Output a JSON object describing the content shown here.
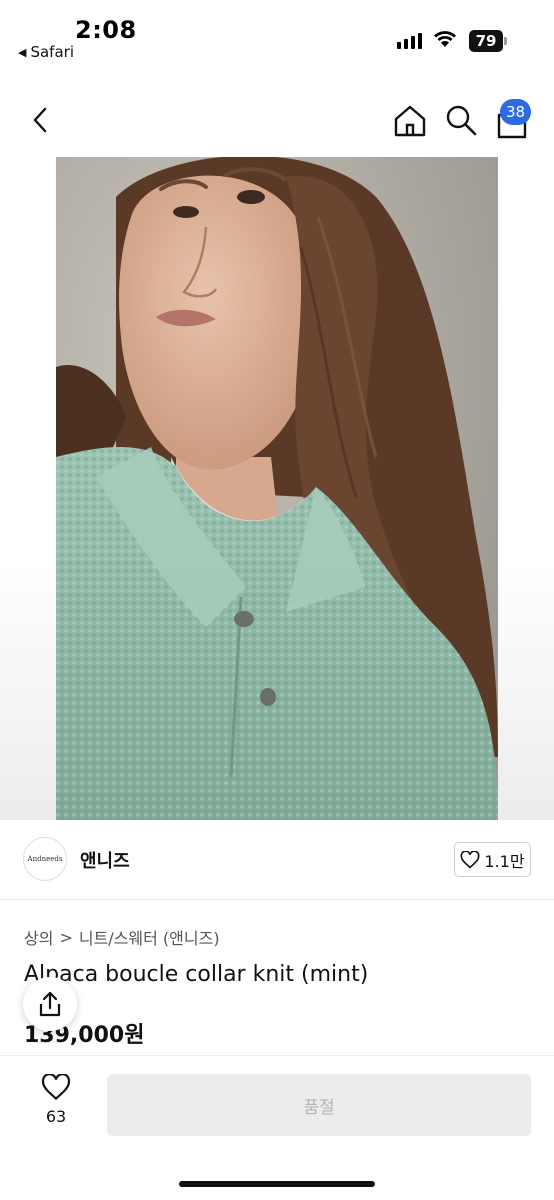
{
  "status_bar": {
    "time": "2:08",
    "back_app": "Safari",
    "battery": "79"
  },
  "nav": {
    "cart_count": "38"
  },
  "brand": {
    "logo_text": "Andneeds",
    "name": "앤니즈",
    "like_count": "1.1만"
  },
  "breadcrumb": {
    "category": "상의",
    "separator": ">",
    "subcategory": "니트/스웨터 (앤니즈)"
  },
  "product": {
    "title": "Alpaca boucle collar knit (mint)",
    "price": "139,000원"
  },
  "bottom": {
    "wish_count": "63",
    "soldout_label": "품절"
  },
  "colors": {
    "accent": "#2d6be4",
    "knit_mint": "#8fb7a6",
    "disabled_bg": "#ececec",
    "disabled_text": "#b5b5b5"
  }
}
